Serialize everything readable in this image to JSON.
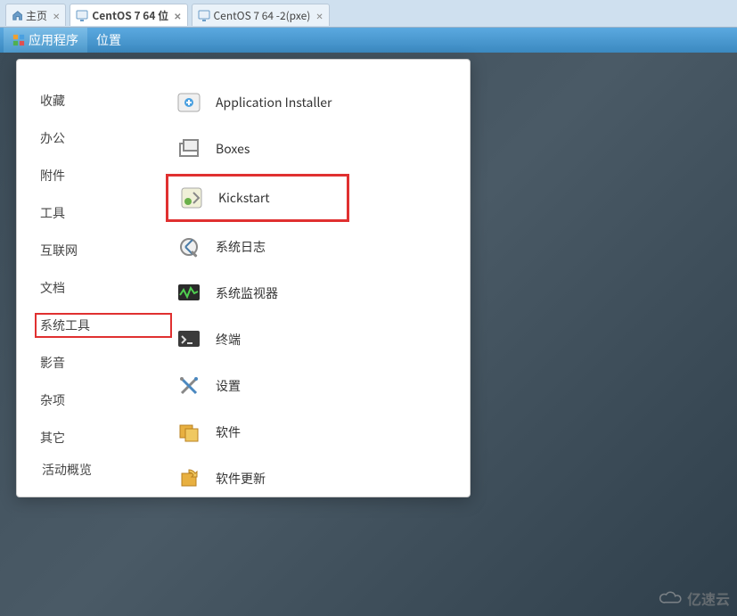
{
  "vm_tabs": [
    {
      "label": "主页",
      "type": "home",
      "active": false,
      "closable": true
    },
    {
      "label": "CentOS 7 64 位",
      "type": "vm",
      "active": true,
      "closable": true
    },
    {
      "label": "CentOS 7 64  -2(pxe)",
      "type": "vm",
      "active": false,
      "closable": true
    }
  ],
  "gnome_menu": {
    "applications": "应用程序",
    "places": "位置"
  },
  "categories": [
    {
      "label": "收藏",
      "highlight": false
    },
    {
      "label": "办公",
      "highlight": false
    },
    {
      "label": "附件",
      "highlight": false
    },
    {
      "label": "工具",
      "highlight": false
    },
    {
      "label": "互联网",
      "highlight": false
    },
    {
      "label": "文档",
      "highlight": false
    },
    {
      "label": "系统工具",
      "highlight": true
    },
    {
      "label": "影音",
      "highlight": false
    },
    {
      "label": "杂项",
      "highlight": false
    },
    {
      "label": "其它",
      "highlight": false
    }
  ],
  "apps": [
    {
      "icon": "installer-icon",
      "label": "Application Installer",
      "highlight": false
    },
    {
      "icon": "boxes-icon",
      "label": "Boxes",
      "highlight": false
    },
    {
      "icon": "kickstart-icon",
      "label": "Kickstart",
      "highlight": true
    },
    {
      "icon": "logs-icon",
      "label": "系统日志",
      "highlight": false
    },
    {
      "icon": "monitor-icon",
      "label": "系统监视器",
      "highlight": false
    },
    {
      "icon": "terminal-icon",
      "label": "终端",
      "highlight": false
    },
    {
      "icon": "settings-icon",
      "label": "设置",
      "highlight": false
    },
    {
      "icon": "software-icon",
      "label": "软件",
      "highlight": false
    },
    {
      "icon": "updater-icon",
      "label": "软件更新",
      "highlight": false
    }
  ],
  "overview_label": "活动概览",
  "watermark": "亿速云"
}
